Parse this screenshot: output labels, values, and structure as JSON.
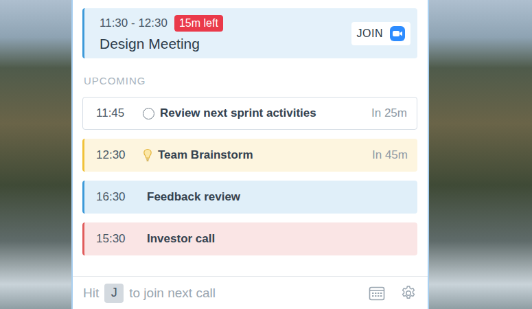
{
  "current": {
    "time": "11:30 - 12:30",
    "badge": "15m left",
    "title": "Design Meeting",
    "join": "JOIN",
    "color": "#3d9ad9"
  },
  "section": "UPCOMING",
  "events": [
    {
      "time": "11:45",
      "title": "Review next sprint activities",
      "relative": "In 25m",
      "kind": "task",
      "color": "#d6dee6"
    },
    {
      "time": "12:30",
      "title": "Team Brainstorm",
      "relative": "In 45m",
      "kind": "idea",
      "color": "#f0c23a"
    },
    {
      "time": "16:30",
      "title": "Feedback review",
      "kind": "event",
      "color": "#3d9ad9"
    },
    {
      "time": "15:30",
      "title": "Investor call",
      "kind": "event",
      "color": "#e05c5c"
    }
  ],
  "footer": {
    "prefix": "Hit",
    "key": "J",
    "suffix": "to join next call"
  }
}
